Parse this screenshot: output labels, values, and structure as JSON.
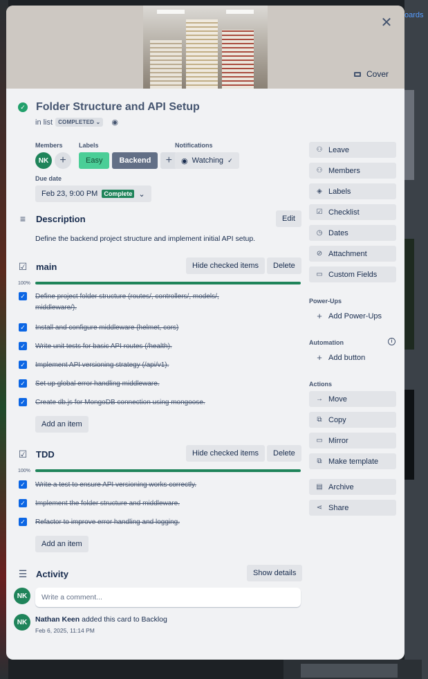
{
  "background": {
    "boards_text": "oards"
  },
  "header": {
    "cover_label": "Cover",
    "close_label": "✕"
  },
  "card": {
    "title": "Folder Structure and API Setup",
    "in_list_prefix": "in list",
    "list_name": "COMPLETED"
  },
  "members": {
    "label": "Members",
    "avatar_initials": "NK",
    "add": "+"
  },
  "labels": {
    "label": "Labels",
    "items": [
      {
        "text": "Easy",
        "color": "#4bce97"
      },
      {
        "text": "Backend",
        "color": "#626f86"
      }
    ],
    "add": "+"
  },
  "notifications": {
    "label": "Notifications",
    "value": "Watching"
  },
  "due": {
    "label": "Due date",
    "value": "Feb 23, 9:00 PM",
    "status": "Complete"
  },
  "description": {
    "title": "Description",
    "edit": "Edit",
    "text": "Define the backend project structure and implement initial API setup."
  },
  "checklists": [
    {
      "title": "main",
      "percent": "100%",
      "progress": 1.0,
      "hide_label": "Hide checked items",
      "delete_label": "Delete",
      "add_label": "Add an item",
      "items": [
        "Define project folder structure (routes/, controllers/, models/, middleware/).",
        "Install and configure middleware (helmet, cors)",
        "Write unit tests for basic API routes (/health).",
        "Implement API versioning strategy (/api/v1).",
        "Set up global error handling middleware.",
        "Create db.js for MongoDB connection using mongoose."
      ]
    },
    {
      "title": "TDD",
      "percent": "100%",
      "progress": 1.0,
      "hide_label": "Hide checked items",
      "delete_label": "Delete",
      "add_label": "Add an item",
      "items": [
        "Write a test to ensure API versioning works correctly.",
        "Implement the folder structure and middleware.",
        "Refactor to improve error handling and logging."
      ]
    }
  ],
  "activity": {
    "title": "Activity",
    "show_details": "Show details",
    "comment_placeholder": "Write a comment...",
    "entries": [
      {
        "initials": "NK",
        "user": "Nathan Keen",
        "action": "added this card to Backlog",
        "time": "Feb 6, 2025, 11:14 PM"
      }
    ]
  },
  "sidebar": {
    "top_buttons": [
      {
        "label": "Leave",
        "icon": "person-icon"
      },
      {
        "label": "Members",
        "icon": "person-icon"
      },
      {
        "label": "Labels",
        "icon": "tag-icon"
      },
      {
        "label": "Checklist",
        "icon": "checkbox-icon"
      },
      {
        "label": "Dates",
        "icon": "clock-icon"
      },
      {
        "label": "Attachment",
        "icon": "paperclip-icon"
      },
      {
        "label": "Custom Fields",
        "icon": "fields-icon"
      }
    ],
    "powerups_label": "Power-Ups",
    "add_powerups": "Add Power-Ups",
    "automation_label": "Automation",
    "add_button": "Add button",
    "actions_label": "Actions",
    "actions": [
      {
        "label": "Move",
        "icon": "arrow-right-icon"
      },
      {
        "label": "Copy",
        "icon": "copy-icon"
      },
      {
        "label": "Mirror",
        "icon": "mirror-icon"
      },
      {
        "label": "Make template",
        "icon": "template-icon"
      },
      {
        "label": "Archive",
        "icon": "archive-icon"
      },
      {
        "label": "Share",
        "icon": "share-icon"
      }
    ]
  },
  "colors": {
    "accent_green": "#1f845a",
    "checkbox_blue": "#0c66e4",
    "complete_green": "#22a06b"
  }
}
